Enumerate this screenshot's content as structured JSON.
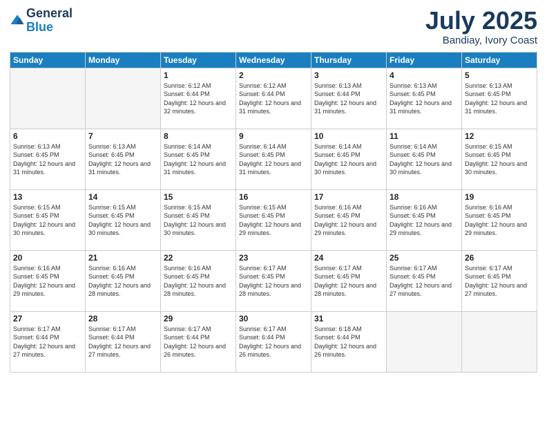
{
  "logo": {
    "general": "General",
    "blue": "Blue"
  },
  "title": "July 2025",
  "subtitle": "Bandiay, Ivory Coast",
  "headers": [
    "Sunday",
    "Monday",
    "Tuesday",
    "Wednesday",
    "Thursday",
    "Friday",
    "Saturday"
  ],
  "weeks": [
    [
      {
        "day": "",
        "info": ""
      },
      {
        "day": "",
        "info": ""
      },
      {
        "day": "1",
        "info": "Sunrise: 6:12 AM\nSunset: 6:44 PM\nDaylight: 12 hours and 32 minutes."
      },
      {
        "day": "2",
        "info": "Sunrise: 6:12 AM\nSunset: 6:44 PM\nDaylight: 12 hours and 31 minutes."
      },
      {
        "day": "3",
        "info": "Sunrise: 6:13 AM\nSunset: 6:44 PM\nDaylight: 12 hours and 31 minutes."
      },
      {
        "day": "4",
        "info": "Sunrise: 6:13 AM\nSunset: 6:45 PM\nDaylight: 12 hours and 31 minutes."
      },
      {
        "day": "5",
        "info": "Sunrise: 6:13 AM\nSunset: 6:45 PM\nDaylight: 12 hours and 31 minutes."
      }
    ],
    [
      {
        "day": "6",
        "info": "Sunrise: 6:13 AM\nSunset: 6:45 PM\nDaylight: 12 hours and 31 minutes."
      },
      {
        "day": "7",
        "info": "Sunrise: 6:13 AM\nSunset: 6:45 PM\nDaylight: 12 hours and 31 minutes."
      },
      {
        "day": "8",
        "info": "Sunrise: 6:14 AM\nSunset: 6:45 PM\nDaylight: 12 hours and 31 minutes."
      },
      {
        "day": "9",
        "info": "Sunrise: 6:14 AM\nSunset: 6:45 PM\nDaylight: 12 hours and 31 minutes."
      },
      {
        "day": "10",
        "info": "Sunrise: 6:14 AM\nSunset: 6:45 PM\nDaylight: 12 hours and 30 minutes."
      },
      {
        "day": "11",
        "info": "Sunrise: 6:14 AM\nSunset: 6:45 PM\nDaylight: 12 hours and 30 minutes."
      },
      {
        "day": "12",
        "info": "Sunrise: 6:15 AM\nSunset: 6:45 PM\nDaylight: 12 hours and 30 minutes."
      }
    ],
    [
      {
        "day": "13",
        "info": "Sunrise: 6:15 AM\nSunset: 6:45 PM\nDaylight: 12 hours and 30 minutes."
      },
      {
        "day": "14",
        "info": "Sunrise: 6:15 AM\nSunset: 6:45 PM\nDaylight: 12 hours and 30 minutes."
      },
      {
        "day": "15",
        "info": "Sunrise: 6:15 AM\nSunset: 6:45 PM\nDaylight: 12 hours and 30 minutes."
      },
      {
        "day": "16",
        "info": "Sunrise: 6:15 AM\nSunset: 6:45 PM\nDaylight: 12 hours and 29 minutes."
      },
      {
        "day": "17",
        "info": "Sunrise: 6:16 AM\nSunset: 6:45 PM\nDaylight: 12 hours and 29 minutes."
      },
      {
        "day": "18",
        "info": "Sunrise: 6:16 AM\nSunset: 6:45 PM\nDaylight: 12 hours and 29 minutes."
      },
      {
        "day": "19",
        "info": "Sunrise: 6:16 AM\nSunset: 6:45 PM\nDaylight: 12 hours and 29 minutes."
      }
    ],
    [
      {
        "day": "20",
        "info": "Sunrise: 6:16 AM\nSunset: 6:45 PM\nDaylight: 12 hours and 29 minutes."
      },
      {
        "day": "21",
        "info": "Sunrise: 6:16 AM\nSunset: 6:45 PM\nDaylight: 12 hours and 28 minutes."
      },
      {
        "day": "22",
        "info": "Sunrise: 6:16 AM\nSunset: 6:45 PM\nDaylight: 12 hours and 28 minutes."
      },
      {
        "day": "23",
        "info": "Sunrise: 6:17 AM\nSunset: 6:45 PM\nDaylight: 12 hours and 28 minutes."
      },
      {
        "day": "24",
        "info": "Sunrise: 6:17 AM\nSunset: 6:45 PM\nDaylight: 12 hours and 28 minutes."
      },
      {
        "day": "25",
        "info": "Sunrise: 6:17 AM\nSunset: 6:45 PM\nDaylight: 12 hours and 27 minutes."
      },
      {
        "day": "26",
        "info": "Sunrise: 6:17 AM\nSunset: 6:45 PM\nDaylight: 12 hours and 27 minutes."
      }
    ],
    [
      {
        "day": "27",
        "info": "Sunrise: 6:17 AM\nSunset: 6:44 PM\nDaylight: 12 hours and 27 minutes."
      },
      {
        "day": "28",
        "info": "Sunrise: 6:17 AM\nSunset: 6:44 PM\nDaylight: 12 hours and 27 minutes."
      },
      {
        "day": "29",
        "info": "Sunrise: 6:17 AM\nSunset: 6:44 PM\nDaylight: 12 hours and 26 minutes."
      },
      {
        "day": "30",
        "info": "Sunrise: 6:17 AM\nSunset: 6:44 PM\nDaylight: 12 hours and 26 minutes."
      },
      {
        "day": "31",
        "info": "Sunrise: 6:18 AM\nSunset: 6:44 PM\nDaylight: 12 hours and 26 minutes."
      },
      {
        "day": "",
        "info": ""
      },
      {
        "day": "",
        "info": ""
      }
    ]
  ]
}
